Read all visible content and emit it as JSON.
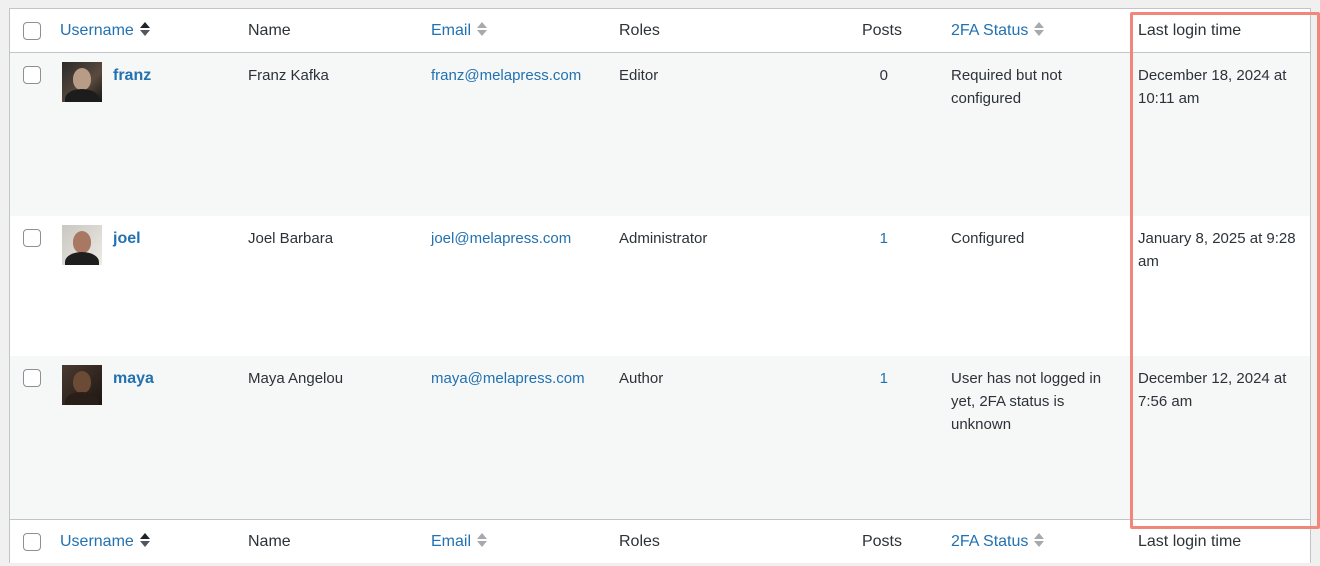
{
  "columns": {
    "username": "Username",
    "name": "Name",
    "email": "Email",
    "roles": "Roles",
    "posts": "Posts",
    "twofa": "2FA Status",
    "last_login": "Last login time"
  },
  "sort_icons": {
    "active": "sort-asc-icon",
    "inactive": "sort-icon"
  },
  "highlight_color": "#f0877a",
  "link_color": "#2271b1",
  "rows": [
    {
      "username": "franz",
      "name": "Franz Kafka",
      "email": "franz@melapress.com",
      "role": "Editor",
      "posts": "0",
      "twofa": "Required but not configured",
      "last_login": "December 18, 2024 at 10:11 am"
    },
    {
      "username": "joel",
      "name": "Joel Barbara",
      "email": "joel@melapress.com",
      "role": "Administrator",
      "posts": "1",
      "twofa": "Configured",
      "last_login": "January 8, 2025 at 9:28 am"
    },
    {
      "username": "maya",
      "name": "Maya Angelou",
      "email": "maya@melapress.com",
      "role": "Author",
      "posts": "1",
      "twofa": "User has not logged in yet, 2FA status is unknown",
      "last_login": "December 12, 2024 at 7:56 am"
    }
  ]
}
